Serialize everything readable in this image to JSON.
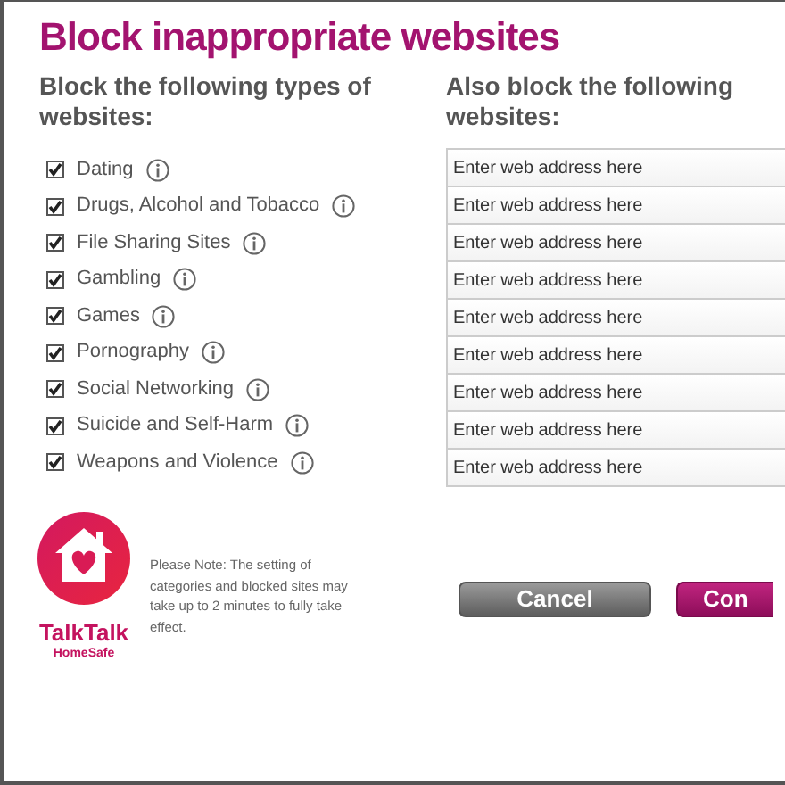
{
  "title": "Block inappropriate websites",
  "categories": {
    "heading": "Block the following types of websites:",
    "items": [
      {
        "label": "Dating",
        "checked": true
      },
      {
        "label": "Drugs, Alcohol and Tobacco",
        "checked": true
      },
      {
        "label": "File Sharing Sites",
        "checked": true
      },
      {
        "label": "Gambling",
        "checked": true
      },
      {
        "label": "Games",
        "checked": true
      },
      {
        "label": "Pornography",
        "checked": true
      },
      {
        "label": "Social Networking",
        "checked": true
      },
      {
        "label": "Suicide and Self-Harm",
        "checked": true
      },
      {
        "label": "Weapons and Violence",
        "checked": true
      }
    ]
  },
  "blocked_sites": {
    "heading": "Also block the following websites:",
    "fields": [
      {
        "placeholder": "Enter web address here"
      },
      {
        "placeholder": "Enter web address here"
      },
      {
        "placeholder": "Enter web address here"
      },
      {
        "placeholder": "Enter web address here"
      },
      {
        "placeholder": "Enter web address here"
      },
      {
        "placeholder": "Enter web address here"
      },
      {
        "placeholder": "Enter web address here"
      },
      {
        "placeholder": "Enter web address here"
      },
      {
        "placeholder": "Enter web address here"
      }
    ]
  },
  "brand": {
    "name": "TalkTalk",
    "product": "HomeSafe"
  },
  "note": "Please Note: The setting of categories and blocked sites may take up to 2 minutes to fully take effect.",
  "buttons": [
    {
      "label": "Cancel",
      "kind": "secondary"
    },
    {
      "label": "Con",
      "kind": "primary"
    }
  ]
}
